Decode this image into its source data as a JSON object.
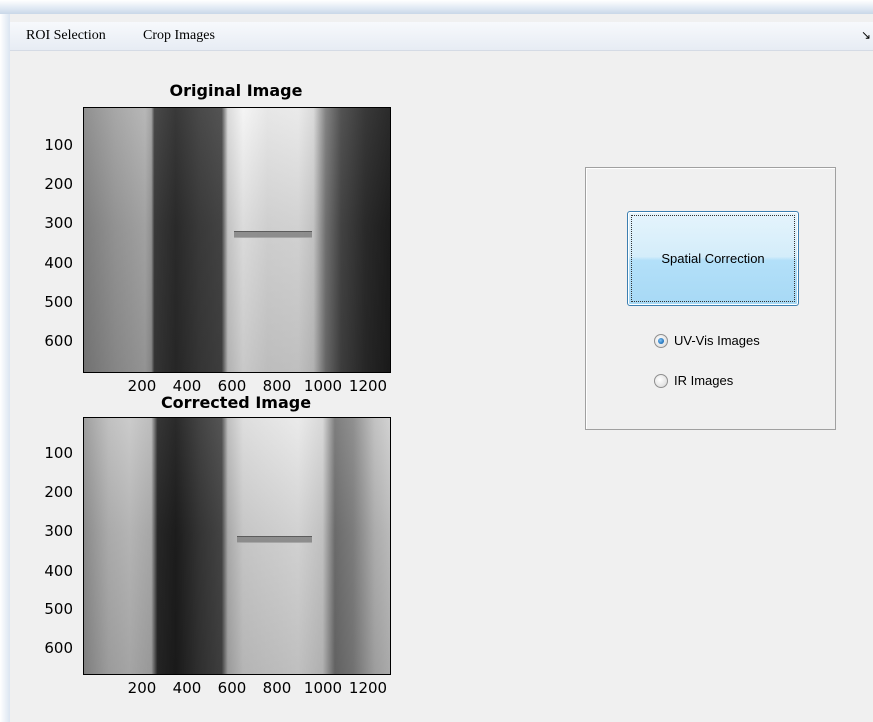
{
  "menubar": {
    "items": [
      {
        "label": "ROI Selection"
      },
      {
        "label": "Crop Images"
      }
    ],
    "overflow_icon": "chevron-right-icon"
  },
  "axes": [
    {
      "title": "Original Image",
      "yticks": [
        "100",
        "200",
        "300",
        "400",
        "500",
        "600"
      ],
      "xticks": [
        "200",
        "400",
        "600",
        "800",
        "1000",
        "1200"
      ]
    },
    {
      "title": "Corrected Image",
      "yticks": [
        "100",
        "200",
        "300",
        "400",
        "500",
        "600"
      ],
      "xticks": [
        "200",
        "400",
        "600",
        "800",
        "1000",
        "1200"
      ]
    }
  ],
  "panel": {
    "button_label": "Spatial Correction",
    "radios": [
      {
        "label": "UV-Vis Images",
        "selected": true
      },
      {
        "label": "IR Images",
        "selected": false
      }
    ]
  },
  "colors": {
    "button_gradient_top": "#e5f4fc",
    "button_gradient_bottom": "#a7d9f5",
    "button_border": "#3c7fb1",
    "window_bg": "#f0f0f0"
  }
}
